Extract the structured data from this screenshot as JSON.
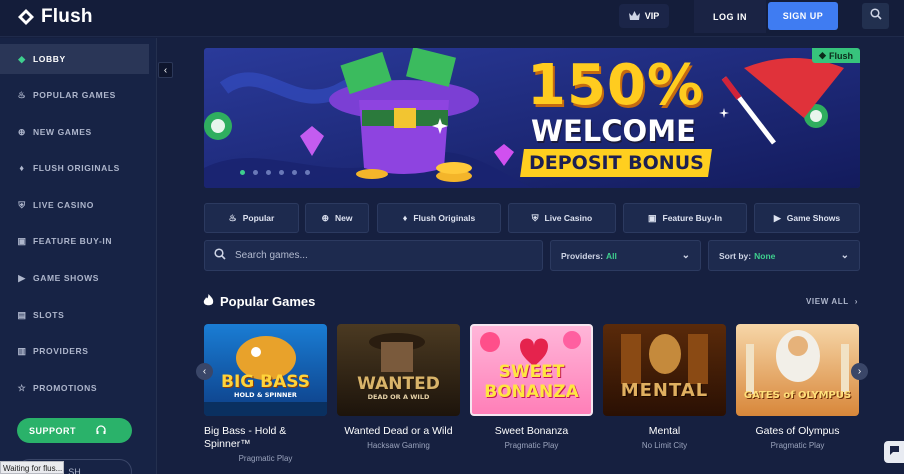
{
  "header": {
    "logo_text": "Flush",
    "vip_label": "VIP",
    "login_label": "LOG IN",
    "signup_label": "SIGN UP"
  },
  "sidebar": {
    "items": [
      {
        "label": "LOBBY",
        "icon": "diamond-icon",
        "active": true
      },
      {
        "label": "POPULAR GAMES",
        "icon": "flame-icon"
      },
      {
        "label": "NEW GAMES",
        "icon": "plus-circle-icon"
      },
      {
        "label": "FLUSH ORIGINALS",
        "icon": "gem-icon"
      },
      {
        "label": "LIVE CASINO",
        "icon": "shield-icon"
      },
      {
        "label": "FEATURE BUY-IN",
        "icon": "bag-icon"
      },
      {
        "label": "GAME SHOWS",
        "icon": "play-icon"
      },
      {
        "label": "SLOTS",
        "icon": "slot-icon"
      },
      {
        "label": "PROVIDERS",
        "icon": "providers-icon"
      },
      {
        "label": "PROMOTIONS",
        "icon": "star-icon"
      }
    ],
    "support_label": "SUPPORT",
    "second_pill_label": "SH",
    "status_text": "Waiting for flus..."
  },
  "banner": {
    "tag": "Flush",
    "line1": "150%",
    "line2": "WELCOME",
    "line3": "DEPOSIT BONUS",
    "slide_count": 6,
    "active_slide": 0
  },
  "tabs": [
    {
      "label": "Popular",
      "icon": "flame-icon"
    },
    {
      "label": "New",
      "icon": "plus-circle-icon"
    },
    {
      "label": "Flush Originals",
      "icon": "gem-icon"
    },
    {
      "label": "Live Casino",
      "icon": "shield-icon"
    },
    {
      "label": "Feature Buy-In",
      "icon": "bag-icon"
    },
    {
      "label": "Game Shows",
      "icon": "play-icon"
    }
  ],
  "filters": {
    "search_placeholder": "Search games...",
    "providers_label": "Providers:",
    "providers_value": "All",
    "sort_label": "Sort by:",
    "sort_value": "None"
  },
  "section": {
    "title": "Popular Games",
    "view_all": "VIEW ALL"
  },
  "games": [
    {
      "title": "Big Bass - Hold & Spinner™",
      "provider": "Pragmatic Play",
      "art_text": "BIG BASS",
      "art_sub": "HOLD & SPINNER"
    },
    {
      "title": "Wanted Dead or a Wild",
      "provider": "Hacksaw Gaming",
      "art_text": "WANTED",
      "art_sub": "DEAD OR A WILD"
    },
    {
      "title": "Sweet Bonanza",
      "provider": "Pragmatic Play",
      "art_text": "SWEET",
      "art_sub": "BONANZA"
    },
    {
      "title": "Mental",
      "provider": "No Limit City",
      "art_text": "MENTAL",
      "art_sub": ""
    },
    {
      "title": "Gates of Olympus",
      "provider": "Pragmatic Play",
      "art_text": "GATES of OLYMPUS",
      "art_sub": ""
    }
  ],
  "colors": {
    "accent_green": "#3ecf8e",
    "signup_blue": "#3f7cf2",
    "banner_gold": "#ffcc1f"
  }
}
